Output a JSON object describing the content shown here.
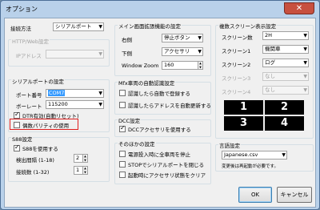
{
  "window": {
    "title": "オプション",
    "close": "✕"
  },
  "connection": {
    "label": "接続方法",
    "value": "シリアルポート"
  },
  "http": {
    "group": "HTTP/Web設定",
    "ip_label": "IPアドレス",
    "ip_value": ""
  },
  "serial": {
    "group": "シリアルポートの設定",
    "port_label": "ポート番号",
    "port_value": "COM7",
    "baud_label": "ボーレート",
    "baud_value": "115200",
    "dtr_label": "DTR有効(自動リセット)",
    "dtr_checked": true,
    "parity_label": "偶数パリティの使用",
    "parity_checked": false
  },
  "s88": {
    "group": "S88設定",
    "use_label": "S88を使用する",
    "use_checked": true,
    "interval_label": "検出間隔 (1-18)",
    "interval_value": "2",
    "count_label": "接続数 (1-32)",
    "count_value": "1"
  },
  "main_screen": {
    "group": "メイン画面拡張機能の設定",
    "right_label": "右側",
    "right_value": "停止ボタン",
    "bottom_label": "下側",
    "bottom_value": "アクセサリ",
    "zoom_label": "Window Zoom",
    "zoom_value": "160"
  },
  "mfx": {
    "group": "Mfx車両の自動認識設定",
    "auto_register": "認識したら自動で登録する",
    "auto_register_checked": false,
    "auto_update": "認識したらアドレスを自動更新する",
    "auto_update_checked": false
  },
  "dcc": {
    "group": "DCC設定",
    "use_dcc": "DCCアクセサリを使用する",
    "use_dcc_checked": true
  },
  "other": {
    "group": "そのほかの設定",
    "item1": "電源投入時に全車両を停止",
    "item1_checked": false,
    "item2": "STOPでシリアルポートを閉じる",
    "item2_checked": false,
    "item3": "起動時にアクセサリ状態をクリア",
    "item3_checked": false
  },
  "multi": {
    "group": "複数スクリーン表示設定",
    "count_label": "スクリーン数",
    "count_value": "2H",
    "s1_label": "スクリーン1",
    "s1_value": "機関車",
    "s2_label": "スクリーン2",
    "s2_value": "ログ",
    "s3_label": "スクリーン3",
    "s3_value": "なし",
    "s4_label": "スクリーン4",
    "s4_value": "なし",
    "preview": [
      "1",
      "2",
      "3",
      "4"
    ]
  },
  "language": {
    "group": "言語設定",
    "value": "Japanese.csv",
    "note": "変更後は再起動が必要です。"
  },
  "buttons": {
    "ok": "OK",
    "cancel": "キャンセル"
  }
}
